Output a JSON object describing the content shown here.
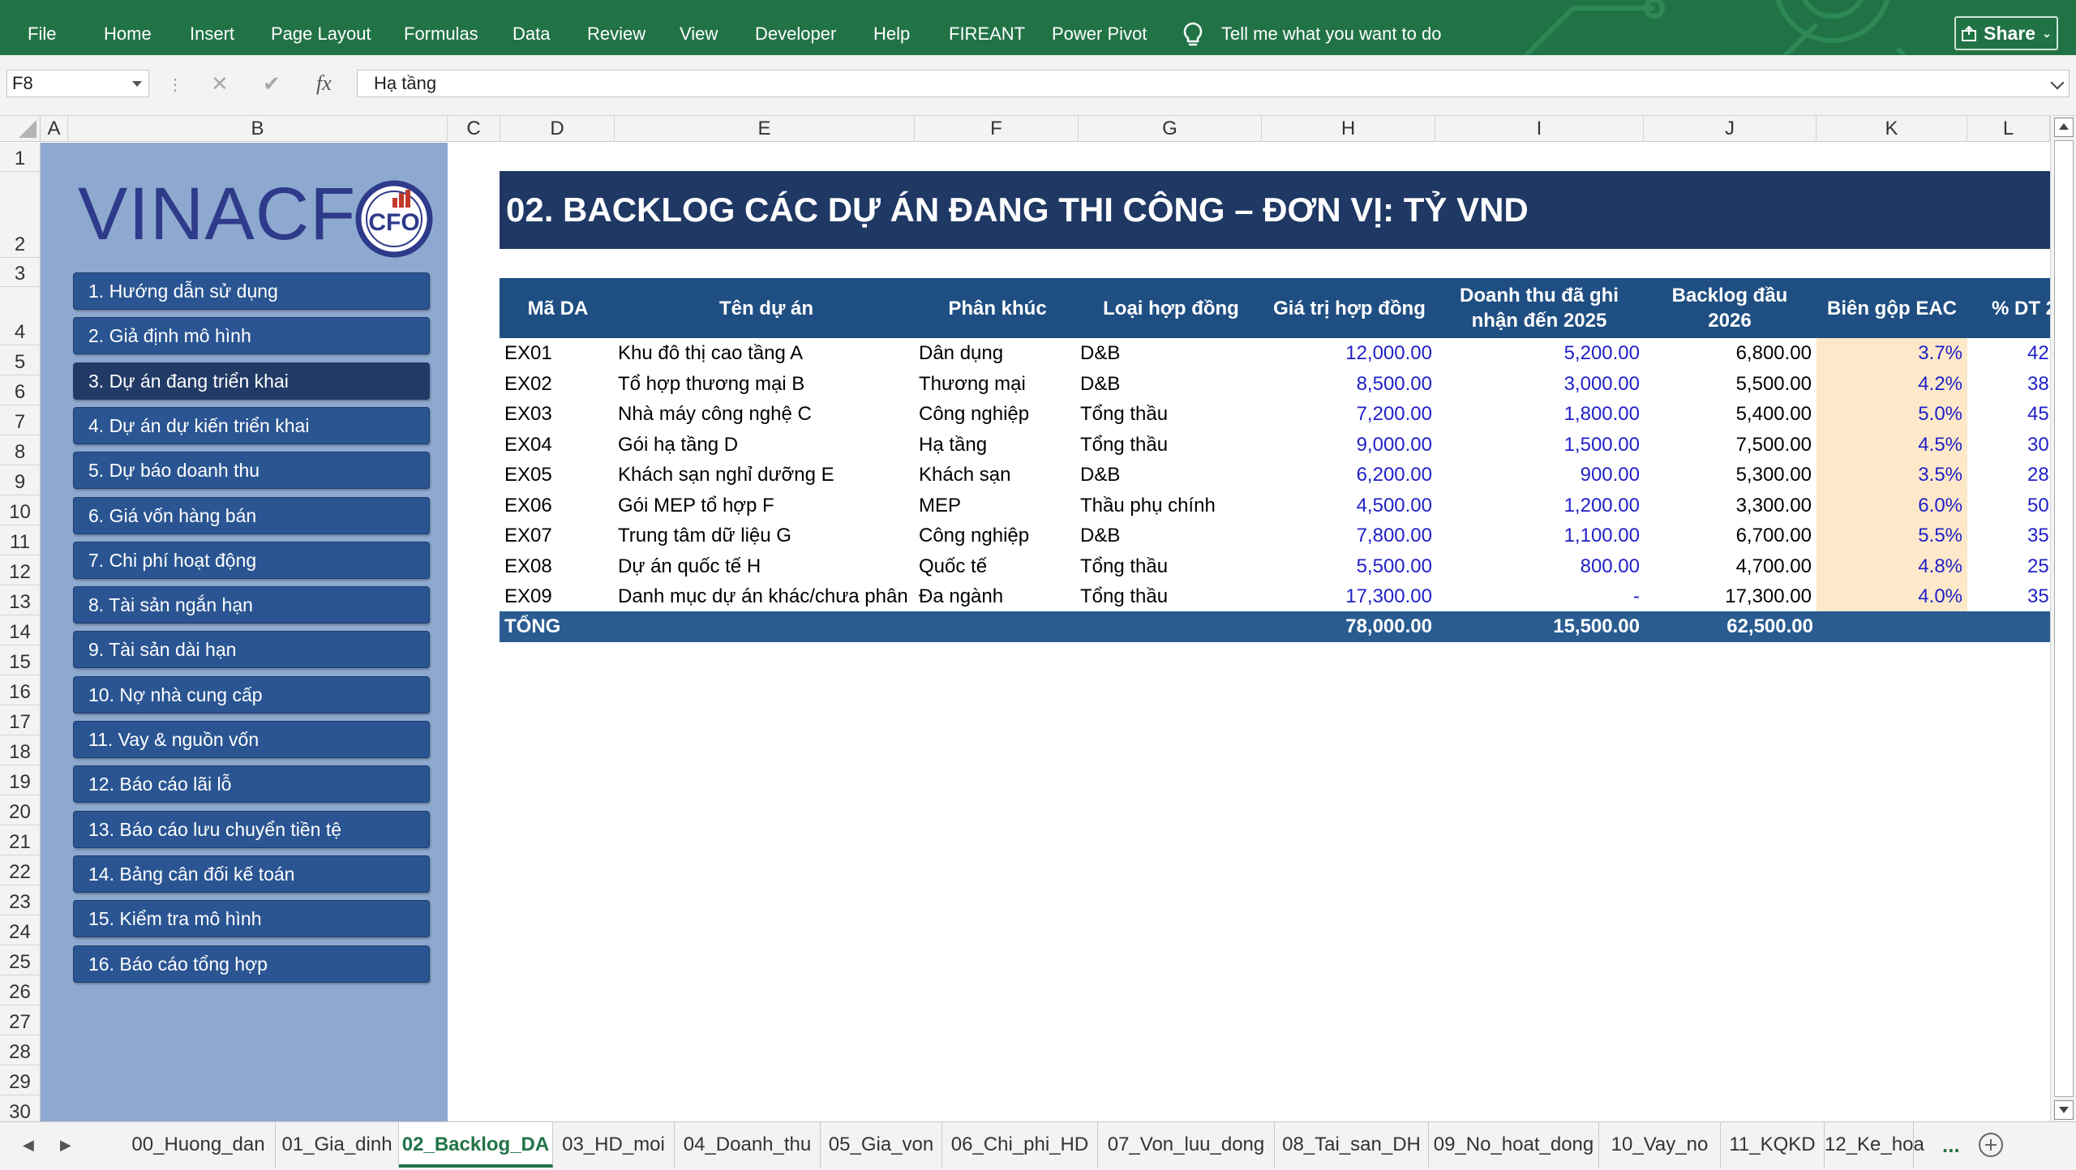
{
  "ribbon": {
    "tabs": [
      "File",
      "Home",
      "Insert",
      "Page Layout",
      "Formulas",
      "Data",
      "Review",
      "View",
      "Developer",
      "Help",
      "FIREANT",
      "Power Pivot"
    ],
    "tell_me": "Tell me what you want to do",
    "share": "Share"
  },
  "formula_bar": {
    "name_box": "F8",
    "cancel_symbol": "✕",
    "enter_symbol": "✔",
    "fx_symbol": "fx",
    "content": "Hạ tầng"
  },
  "columns": [
    "A",
    "B",
    "C",
    "D",
    "E",
    "F",
    "G",
    "H",
    "I",
    "J",
    "K",
    "L"
  ],
  "rows": [
    "1",
    "2",
    "3",
    "4",
    "5",
    "6",
    "7",
    "8",
    "9",
    "10",
    "11",
    "12",
    "13",
    "14",
    "15",
    "16",
    "17",
    "18",
    "19",
    "20",
    "21",
    "22",
    "23",
    "24",
    "25",
    "26",
    "27",
    "28",
    "29",
    "30"
  ],
  "sidebar": {
    "logo_text": "VINACF",
    "logo_badge": "CFO",
    "items": [
      {
        "label": "1. Hướng dẫn sử dụng"
      },
      {
        "label": "2. Giả định mô hình"
      },
      {
        "label": "3. Dự án đang triển khai"
      },
      {
        "label": "4. Dự án dự kiến triển khai"
      },
      {
        "label": "5. Dự báo doanh thu"
      },
      {
        "label": "6. Giá vốn hàng bán"
      },
      {
        "label": "7. Chi phí hoạt động"
      },
      {
        "label": "8. Tài sản ngắn hạn"
      },
      {
        "label": "9. Tài sản dài hạn"
      },
      {
        "label": "10. Nợ nhà cung cấp"
      },
      {
        "label": "11. Vay & nguồn vốn"
      },
      {
        "label": "12. Báo cáo lãi lỗ"
      },
      {
        "label": "13. Báo cáo lưu chuyển tiền tệ"
      },
      {
        "label": "14. Bảng cân đối kế toán"
      },
      {
        "label": "15. Kiểm tra mô hình"
      },
      {
        "label": "16. Báo cáo tổng hợp"
      }
    ],
    "active_index": 2
  },
  "sheet": {
    "title": "02. BACKLOG CÁC DỰ ÁN ĐANG THI CÔNG – ĐƠN VỊ: TỶ VND",
    "headers": {
      "code": "Mã DA",
      "name": "Tên dự án",
      "segment": "Phân khúc",
      "contract_type": "Loại hợp đồng",
      "contract_value": "Giá trị hợp đồng",
      "revenue_recognized_1": "Doanh thu đã ghi",
      "revenue_recognized_2": "nhận đến 2025",
      "backlog_1": "Backlog đầu",
      "backlog_2": "2026",
      "margin": "Biên gộp EAC",
      "pct_dt": "% DT 2"
    },
    "rows": [
      {
        "code": "EX01",
        "name": "Khu đô thị cao tầng A",
        "segment": "Dân dụng",
        "contract_type": "D&B",
        "contract_value": "12,000.00",
        "revenue": "5,200.00",
        "backlog": "6,800.00",
        "margin": "3.7%",
        "pct": "42"
      },
      {
        "code": "EX02",
        "name": "Tổ hợp thương mại B",
        "segment": "Thương mại",
        "contract_type": "D&B",
        "contract_value": "8,500.00",
        "revenue": "3,000.00",
        "backlog": "5,500.00",
        "margin": "4.2%",
        "pct": "38"
      },
      {
        "code": "EX03",
        "name": "Nhà máy công nghệ C",
        "segment": "Công nghiệp",
        "contract_type": "Tổng thầu",
        "contract_value": "7,200.00",
        "revenue": "1,800.00",
        "backlog": "5,400.00",
        "margin": "5.0%",
        "pct": "45"
      },
      {
        "code": "EX04",
        "name": "Gói hạ tầng D",
        "segment": "Hạ tầng",
        "contract_type": "Tổng thầu",
        "contract_value": "9,000.00",
        "revenue": "1,500.00",
        "backlog": "7,500.00",
        "margin": "4.5%",
        "pct": "30"
      },
      {
        "code": "EX05",
        "name": "Khách sạn nghỉ dưỡng E",
        "segment": "Khách sạn",
        "contract_type": "D&B",
        "contract_value": "6,200.00",
        "revenue": "900.00",
        "backlog": "5,300.00",
        "margin": "3.5%",
        "pct": "28"
      },
      {
        "code": "EX06",
        "name": "Gói MEP tổ hợp F",
        "segment": "MEP",
        "contract_type": "Thầu phụ chính",
        "contract_value": "4,500.00",
        "revenue": "1,200.00",
        "backlog": "3,300.00",
        "margin": "6.0%",
        "pct": "50"
      },
      {
        "code": "EX07",
        "name": "Trung tâm dữ liệu G",
        "segment": "Công nghiệp",
        "contract_type": "D&B",
        "contract_value": "7,800.00",
        "revenue": "1,100.00",
        "backlog": "6,700.00",
        "margin": "5.5%",
        "pct": "35"
      },
      {
        "code": "EX08",
        "name": "Dự án quốc tế H",
        "segment": "Quốc tế",
        "contract_type": "Tổng thầu",
        "contract_value": "5,500.00",
        "revenue": "800.00",
        "backlog": "4,700.00",
        "margin": "4.8%",
        "pct": "25"
      },
      {
        "code": "EX09",
        "name": "Danh mục dự án khác/chưa phân",
        "segment": "Đa ngành",
        "contract_type": "Tổng thầu",
        "contract_value": "17,300.00",
        "revenue": "-",
        "backlog": "17,300.00",
        "margin": "4.0%",
        "pct": "35"
      }
    ],
    "total": {
      "label": "TỔNG",
      "contract_value": "78,000.00",
      "revenue": "15,500.00",
      "backlog": "62,500.00"
    }
  },
  "sheet_tabs": {
    "tabs": [
      "00_Huong_dan",
      "01_Gia_dinh",
      "02_Backlog_DA",
      "03_HD_moi",
      "04_Doanh_thu",
      "05_Gia_von",
      "06_Chi_phi_HD",
      "07_Von_luu_dong",
      "08_Tai_san_DH",
      "09_No_hoat_dong",
      "10_Vay_no",
      "11_KQKD",
      "12_Ke_hoa"
    ],
    "active_index": 2,
    "more": "..."
  },
  "colors": {
    "ribbon": "#217346",
    "title_band": "#1f3864",
    "header": "#1f4e82",
    "sidebar": "#8ea9cf",
    "nav_button": "#2a5592",
    "input_blue": "#1f1fc8",
    "shade": "#fde9c9"
  }
}
